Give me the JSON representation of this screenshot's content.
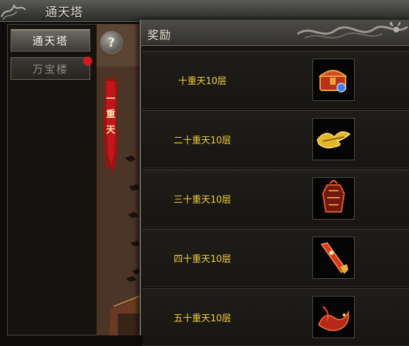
{
  "window": {
    "title": "通天塔"
  },
  "nav": {
    "items": [
      {
        "label": "通天塔",
        "active": true
      },
      {
        "label": "万宝楼",
        "active": false,
        "badge_color": "#e0141a"
      }
    ]
  },
  "help": {
    "symbol": "?"
  },
  "tower": {
    "floor_banner": "一重天"
  },
  "rewards": {
    "title": "奖励",
    "rows": [
      {
        "label": "十重天10层",
        "icon": "treasure-chest-icon"
      },
      {
        "label": "二十重天10层",
        "icon": "golden-wings-icon"
      },
      {
        "label": "三十重天10层",
        "icon": "flame-armor-icon"
      },
      {
        "label": "四十重天10层",
        "icon": "fire-blade-icon"
      },
      {
        "label": "五十重天10层",
        "icon": "fire-dragon-icon"
      }
    ]
  },
  "colors": {
    "label_gold": "#f2cf3a",
    "badge_red": "#e0141a"
  }
}
